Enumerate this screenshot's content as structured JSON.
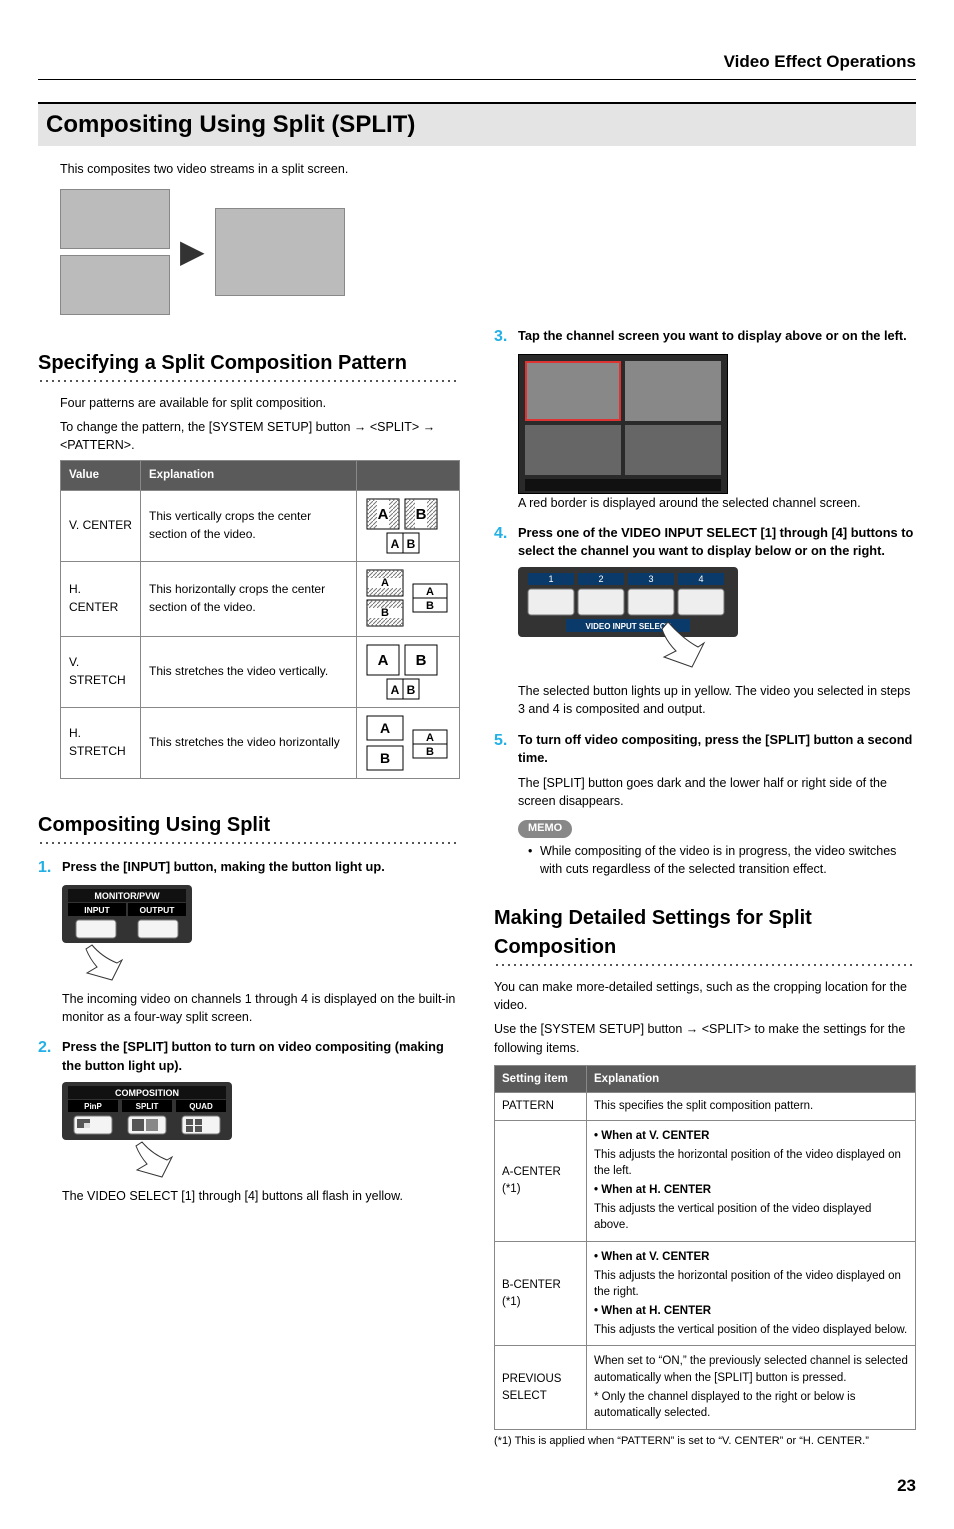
{
  "running_head": "Video Effect Operations",
  "h1": "Compositing Using Split (SPLIT)",
  "intro": "This composites two video streams in a split screen.",
  "sec_specify": {
    "title": "Specifying a Split Composition Pattern",
    "p1": "Four patterns are available for split composition.",
    "p2": "To change the pattern, the [SYSTEM SETUP] button → <SPLIT> → <PATTERN>.",
    "th_value": "Value",
    "th_expl": "Explanation",
    "rows": [
      {
        "value": "V. CENTER",
        "expl": "This vertically crops the center section of the video."
      },
      {
        "value": "H. CENTER",
        "expl": "This horizontally crops the center section of the video."
      },
      {
        "value": "V. STRETCH",
        "expl": "This stretches the video vertically."
      },
      {
        "value": "H. STRETCH",
        "expl": "This stretches the video horizontally"
      }
    ]
  },
  "sec_using": {
    "title": "Compositing Using Split",
    "steps": {
      "s1": "Press the [INPUT] button, making the button light up.",
      "s1_body": "The incoming video on channels 1 through 4 is displayed on the built-in monitor as a four-way split screen.",
      "s2": "Press the [SPLIT] button to turn on video compositing (making the button light up).",
      "s2_body": "The VIDEO SELECT [1] through [4] buttons all flash in yellow.",
      "s3": "Tap the channel screen you want to display above or on the left.",
      "s3_body": "A red border is displayed around the selected channel screen.",
      "s4": "Press one of the VIDEO INPUT SELECT [1] through [4] buttons to select the channel you want to display below or on the right.",
      "s4_body": "The selected button lights up in yellow. The video you selected in steps 3 and 4 is composited and output.",
      "s5": "To turn off video compositing, press the [SPLIT] button a second time.",
      "s5_body": "The [SPLIT] button goes dark and the lower half or right side of the screen disappears."
    },
    "memo_label": "MEMO",
    "memo_bullet": "While compositing of the video is in progress, the video switches with cuts regardless of the selected transition effect.",
    "panel1_title": "MONITOR/PVW",
    "panel1_left": "INPUT",
    "panel1_right": "OUTPUT",
    "panel2_title": "COMPOSITION",
    "panel2_a": "PinP",
    "panel2_b": "SPLIT",
    "panel2_c": "QUAD",
    "panel3_label": "VIDEO INPUT SELECT",
    "panel3_nums": [
      "1",
      "2",
      "3",
      "4"
    ]
  },
  "sec_detail": {
    "title": "Making Detailed Settings for Split Composition",
    "p1": "You can make more-detailed settings, such as the cropping location for the video.",
    "p2": "Use the [SYSTEM SETUP] button → <SPLIT> to make the settings for the following items.",
    "th_item": "Setting item",
    "th_expl": "Explanation",
    "rows": {
      "pattern": {
        "name": "PATTERN",
        "expl": "This specifies the split composition pattern."
      },
      "acenter": {
        "name": "A-CENTER (*1)",
        "l1": "•  When at V. CENTER",
        "l2": "This adjusts the horizontal position of the video displayed on the left.",
        "l3": "•  When at H. CENTER",
        "l4": "This adjusts the vertical position of the video displayed above."
      },
      "bcenter": {
        "name": "B-CENTER (*1)",
        "l1": "•  When at V. CENTER",
        "l2": "This adjusts the horizontal position of the video displayed on the right.",
        "l3": "•  When at H. CENTER",
        "l4": "This adjusts the vertical position of the video displayed below."
      },
      "prev": {
        "name": "PREVIOUS SELECT",
        "l1": "When set to “ON,” the previously selected channel is selected automatically when the [SPLIT] button is pressed.",
        "l2": "*  Only the channel displayed to the right or below is automatically selected."
      }
    },
    "footnote": "(*1)   This is applied when “PATTERN” is set to “V. CENTER” or “H. CENTER.”"
  },
  "page_number": "23"
}
